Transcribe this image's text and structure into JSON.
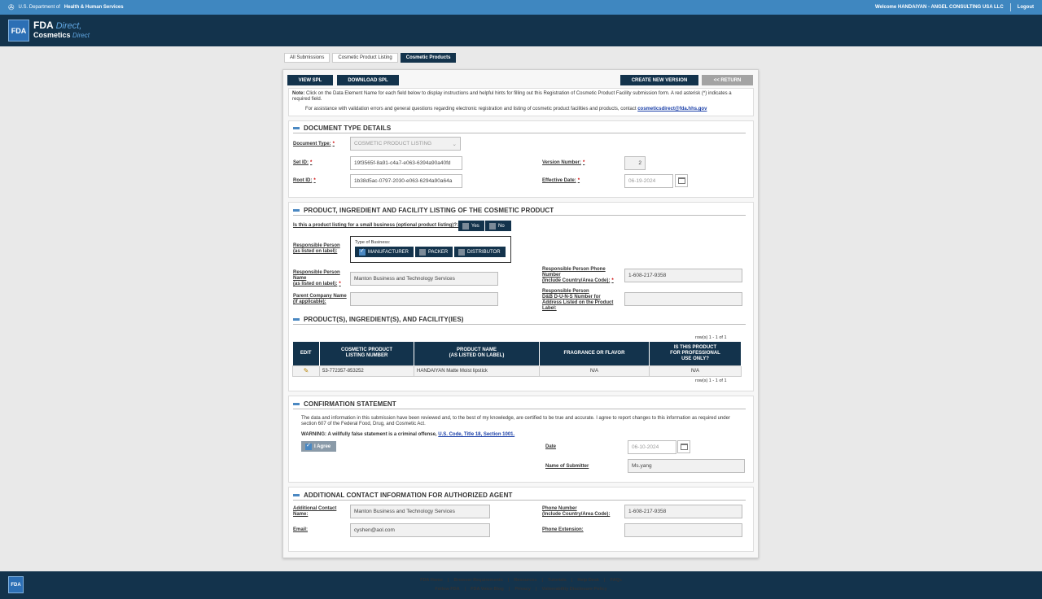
{
  "topbar": {
    "hhs_prefix": "U.S. Department of",
    "hhs_bold": "Health & Human Services",
    "welcome": "Welcome HANDAIYAN - ANGEL CONSULTING USA LLC",
    "logout": "Logout"
  },
  "brand": {
    "logo": "FDA",
    "line1": "FDA",
    "line1_italic": "Direct,",
    "line2": "Cosmetics",
    "line2_italic": "Direct"
  },
  "breadcrumb": [
    "All Submissions",
    "Cosmetic Product Listing",
    "Cosmetic Products"
  ],
  "toolbar": {
    "view_spl": "VIEW SPL",
    "download_spl": "DOWNLOAD SPL",
    "create_version": "CREATE NEW VERSION",
    "return": "<< RETURN"
  },
  "note": {
    "label": "Note:",
    "text1": "Click on the Data Element Name for each field below to display instructions and helpful hints for filling out this Registration of Cosmetic Product Facility submission form. A red asterisk (*) indicates a",
    "text2": "required field.",
    "assist": "For assistance with validation errors and general questions regarding electronic registration and listing of cosmetic product facilities and products, contact",
    "email": "cosmeticsdirect@fda.hhs.gov"
  },
  "doc_type": {
    "title": "DOCUMENT TYPE DETAILS",
    "document_type_label": "Document Type:",
    "document_type_value": "COSMETIC PRODUCT LISTING",
    "set_id_label": "Set ID:",
    "set_id_value": "19f3565f-8a91-c4a7-e063-6394a90a40fd",
    "root_id_label": "Root ID:",
    "root_id_value": "1b38d5ac-0797-2030-e063-6294a90a64a",
    "version_label": "Version Number:",
    "version_value": "2",
    "effective_label": "Effective Date:",
    "effective_value": "06-19-2024"
  },
  "listing": {
    "title": "PRODUCT, INGREDIENT AND FACILITY LISTING OF THE COSMETIC PRODUCT",
    "small_business_q": "Is this a product listing for a small business (optional product listing)?:",
    "yes": "Yes",
    "no": "No",
    "rp_label1": "Responsible Person",
    "rp_label2": "(as listed on label):",
    "type_business": "Type of Business:",
    "manufacturer": "MANUFACTURER",
    "packer": "PACKER",
    "distributor": "DISTRIBUTOR",
    "rp_name_l1": "Responsible Person",
    "rp_name_l2": "Name",
    "rp_name_l3": "(as listed on label):",
    "rp_name_value": "Manton Business and Technology Services",
    "parent_l1": "Parent Company Name",
    "parent_l2": "(if applicable):",
    "parent_value": "",
    "phone_l1": "Responsible Person Phone",
    "phone_l2": "Number",
    "phone_l3": "(Include Country/Area Code):",
    "phone_value": "1-608-217-9358",
    "duns_l1": "Responsible Person",
    "duns_l2": "D&B D-U-N-S Number for",
    "duns_l3": "Address Listed on the Product",
    "duns_l4": "Label:",
    "duns_value": ""
  },
  "products": {
    "title": "PRODUCT(S), INGREDIENT(S), AND FACILITY(IES)",
    "rows_top": "row(s) 1 - 1 of 1",
    "rows_bottom": "row(s) 1 - 1 of 1",
    "columns": [
      "EDIT",
      "COSMETIC PRODUCT\nLISTING NUMBER",
      "PRODUCT NAME\n(AS LISTED ON LABEL)",
      "FRAGRANCE OR FLAVOR",
      "IS THIS PRODUCT\nFOR PROFESSIONAL\nUSE ONLY?"
    ],
    "row": {
      "listing_number": "53-772357-853252",
      "product_name": "HANDAIYAN Matte Moist lipstick",
      "fragrance": "N/A",
      "professional": "N/A"
    }
  },
  "confirmation": {
    "title": "CONFIRMATION STATEMENT",
    "text1": "The data and information in this submission have been reviewed and, to the best of my knowledge, are certified to be true and accurate. I agree to report changes to this information as required under",
    "text2": "section 607 of the Federal Food, Drug, and Cosmetic Act.",
    "warning": "WARNING: A willfully false statement is a criminal offense,",
    "warning_link": "U.S. Code, Title 18, Section 1001.",
    "agree": "I Agree",
    "date_label": "Date",
    "date_value": "06-10-2024",
    "submitter_label": "Name of Submitter",
    "submitter_value": "Ms.yang"
  },
  "agent": {
    "title": "ADDITIONAL CONTACT INFORMATION FOR AUTHORIZED AGENT",
    "contact_l1": "Additional Contact",
    "contact_l2": "Name:",
    "contact_value": "Manton Business and Technology Services",
    "email_label": "Email:",
    "email_value": "cyshen@aol.com",
    "phone_l1": "Phone Number",
    "phone_l2": "(Include Country/Area Code):",
    "phone_value": "1-608-217-9358",
    "ext_label": "Phone Extension:",
    "ext_value": ""
  },
  "footer": {
    "logo": "FDA",
    "row1": [
      "FDA Home",
      "|",
      "Browser Requirements",
      "|",
      "Resources",
      "|",
      "Tutorials",
      "|",
      "Help Desk",
      "|",
      "FAQs"
    ],
    "row2": [
      "Follow FDA",
      "|",
      "FDA Voice Blog",
      "|",
      "Privacy",
      "|",
      "Vulnerability Disclosure Policy"
    ]
  }
}
